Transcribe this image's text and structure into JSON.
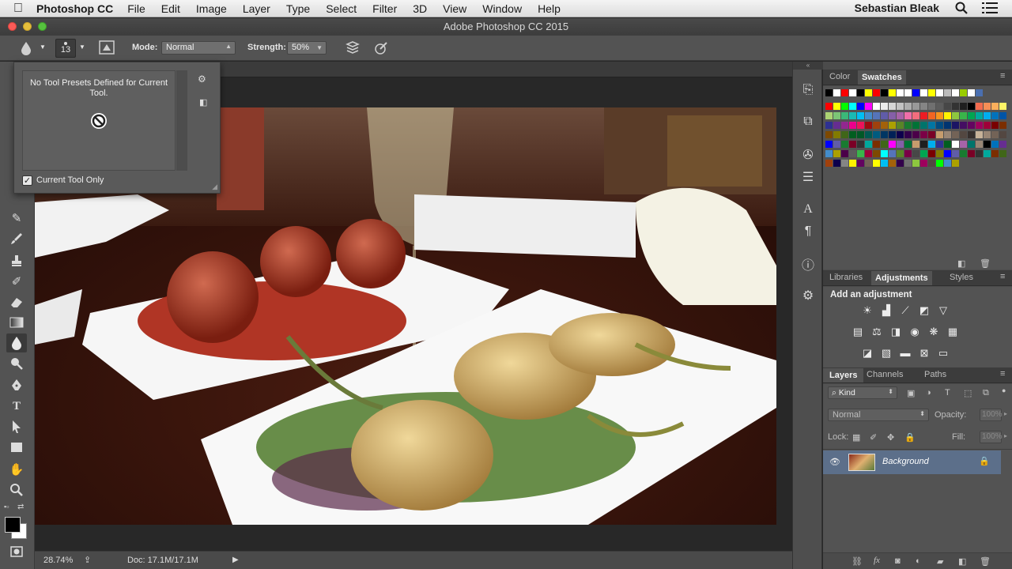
{
  "menubar": {
    "app_name": "Photoshop CC",
    "items": [
      "File",
      "Edit",
      "Image",
      "Layer",
      "Type",
      "Select",
      "Filter",
      "3D",
      "View",
      "Window",
      "Help"
    ],
    "user": "Sebastian Bleak"
  },
  "window": {
    "title": "Adobe Photoshop CC 2015"
  },
  "options": {
    "brush_size": "13",
    "mode_label": "Mode:",
    "mode_value": "Normal",
    "strength_label": "Strength:",
    "strength_value": "50%"
  },
  "preset_popup": {
    "message": "No Tool Presets Defined for Current Tool.",
    "checkbox_label": "Current Tool Only",
    "checkbox_checked": true
  },
  "status": {
    "zoom": "28.74%",
    "doc": "Doc: 17.1M/17.1M"
  },
  "color_panel": {
    "tabs": [
      "Color",
      "Swatches"
    ],
    "active_tab": "Swatches"
  },
  "adjustments_panel": {
    "tabs": [
      "Libraries",
      "Adjustments",
      "Styles"
    ],
    "active_tab": "Adjustments",
    "heading": "Add an adjustment"
  },
  "layers_panel": {
    "tabs": [
      "Layers",
      "Channels",
      "Paths"
    ],
    "active_tab": "Layers",
    "filter_label": "Kind",
    "blend_mode": "Normal",
    "opacity_label": "Opacity:",
    "opacity_value": "100%",
    "lock_label": "Lock:",
    "fill_label": "Fill:",
    "fill_value": "100%",
    "layers": [
      {
        "name": "Background",
        "visible": true,
        "locked": true
      }
    ]
  },
  "colors": {
    "accent_selected": "#5c6f8a",
    "panel_bg": "#535353"
  }
}
